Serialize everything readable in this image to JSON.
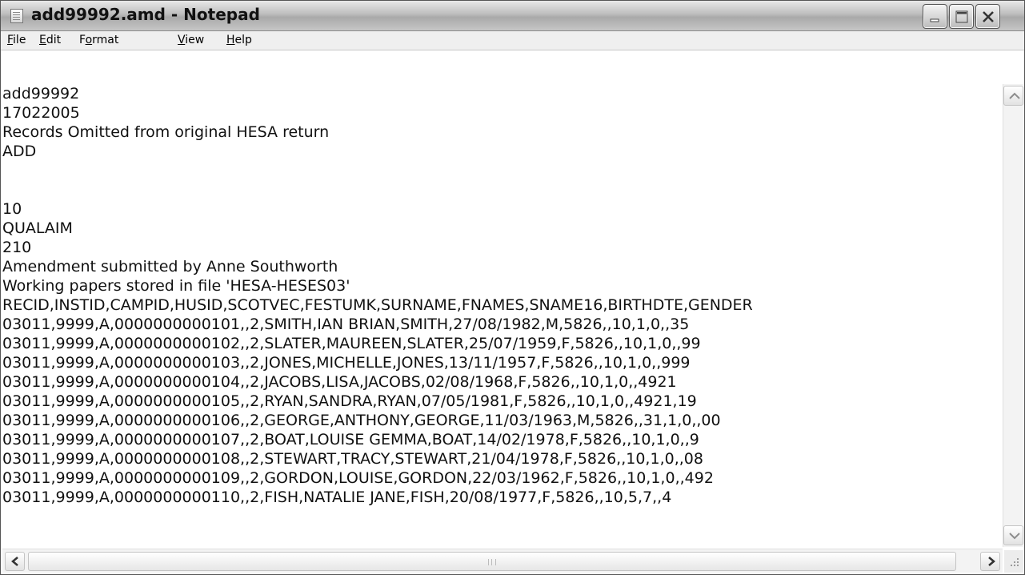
{
  "window": {
    "title": "add99992.amd - Notepad",
    "controls": {
      "minimize": "minimize",
      "maximize": "maximize",
      "close": "close"
    }
  },
  "menu": {
    "items": [
      {
        "key": "F",
        "rest": "ile"
      },
      {
        "key": "E",
        "rest": "dit"
      },
      {
        "pre": "F",
        "key": "o",
        "rest": "rmat"
      },
      {
        "key": "V",
        "rest": "iew"
      },
      {
        "key": "H",
        "rest": "elp"
      }
    ]
  },
  "document": {
    "lines": [
      "add99992",
      "17022005",
      "Records Omitted from original HESA return",
      "ADD",
      "",
      "",
      "10",
      "QUALAIM",
      "210",
      "Amendment submitted by Anne Southworth",
      "Working papers stored in file 'HESA-HESES03'",
      "RECID,INSTID,CAMPID,HUSID,SCOTVEC,FESTUMK,SURNAME,FNAMES,SNAME16,BIRTHDTE,GENDER",
      "03011,9999,A,0000000000101,,2,SMITH,IAN BRIAN,SMITH,27/08/1982,M,5826,,10,1,0,,35",
      "03011,9999,A,0000000000102,,2,SLATER,MAUREEN,SLATER,25/07/1959,F,5826,,10,1,0,,99",
      "03011,9999,A,0000000000103,,2,JONES,MICHELLE,JONES,13/11/1957,F,5826,,10,1,0,,999",
      "03011,9999,A,0000000000104,,2,JACOBS,LISA,JACOBS,02/08/1968,F,5826,,10,1,0,,4921",
      "03011,9999,A,0000000000105,,2,RYAN,SANDRA,RYAN,07/05/1981,F,5826,,10,1,0,,4921,19",
      "03011,9999,A,0000000000106,,2,GEORGE,ANTHONY,GEORGE,11/03/1963,M,5826,,31,1,0,,00",
      "03011,9999,A,0000000000107,,2,BOAT,LOUISE GEMMA,BOAT,14/02/1978,F,5826,,10,1,0,,9",
      "03011,9999,A,0000000000108,,2,STEWART,TRACY,STEWART,21/04/1978,F,5826,,10,1,0,,08",
      "03011,9999,A,0000000000109,,2,GORDON,LOUISE,GORDON,22/03/1962,F,5826,,10,1,0,,492",
      "03011,9999,A,0000000000110,,2,FISH,NATALIE JANE,FISH,20/08/1977,F,5826,,10,5,7,,4"
    ]
  },
  "icons": {
    "app": "notepad-icon",
    "scroll_up": "arrow-up-icon",
    "scroll_down": "arrow-down-icon",
    "scroll_left": "arrow-left-icon",
    "scroll_right": "arrow-right-icon"
  }
}
